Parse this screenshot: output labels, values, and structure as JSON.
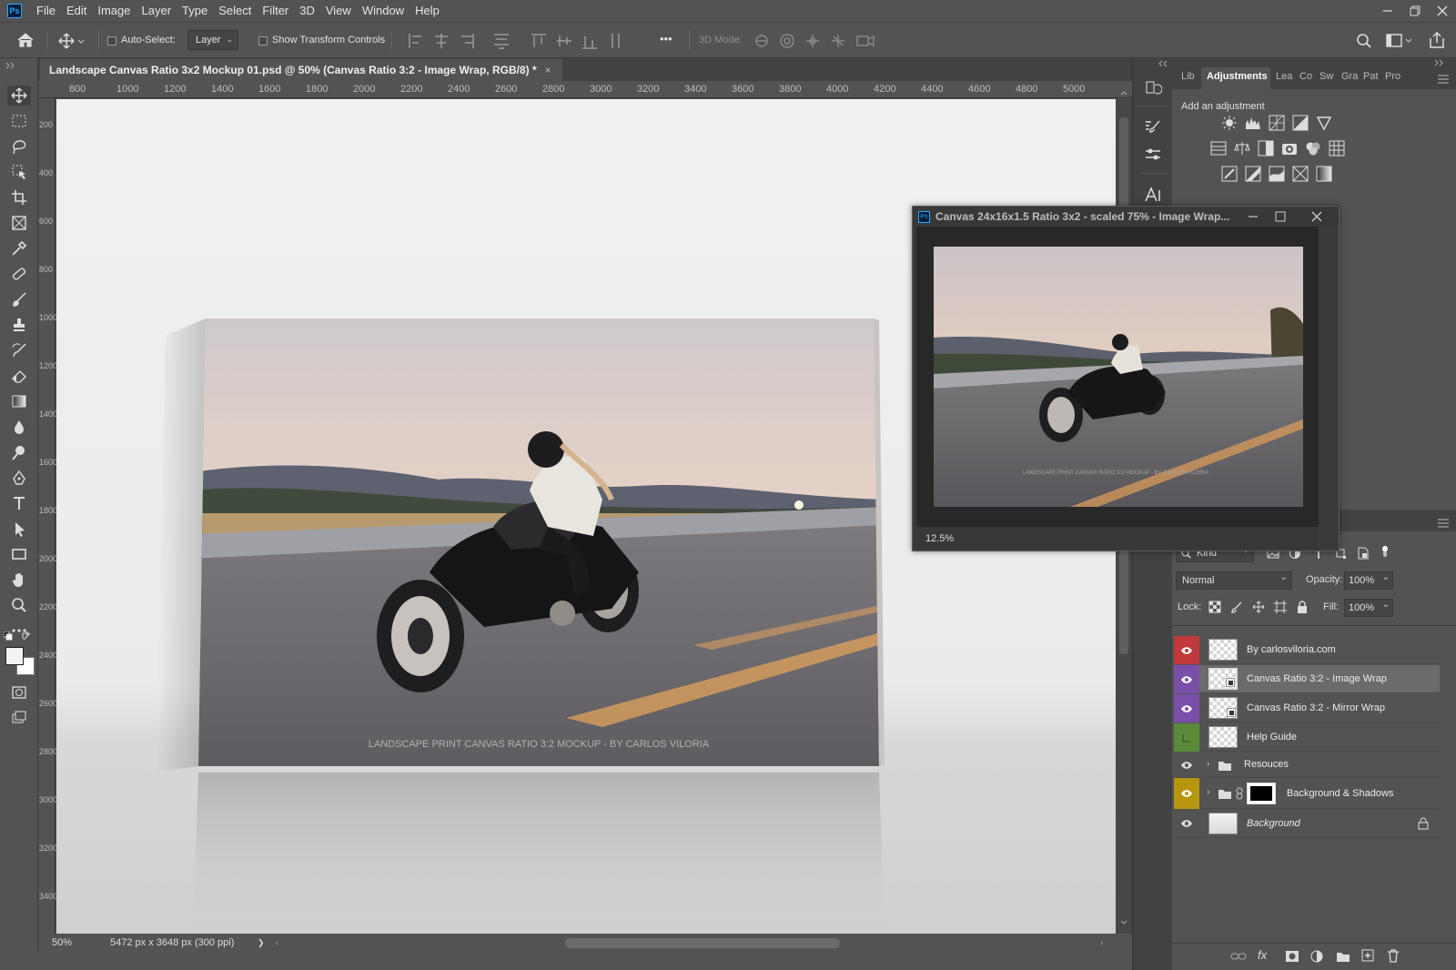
{
  "app": {
    "logo": "Ps"
  },
  "menu": [
    "File",
    "Edit",
    "Image",
    "Layer",
    "Type",
    "Select",
    "Filter",
    "3D",
    "View",
    "Window",
    "Help"
  ],
  "options_bar": {
    "auto_select_label": "Auto-Select:",
    "auto_select_target": "Layer",
    "show_transform_label": "Show Transform Controls",
    "more": "•••",
    "mode_3d_label": "3D Mode:"
  },
  "document": {
    "tab_title": "Landscape Canvas Ratio 3x2 Mockup 01.psd @ 50% (Canvas Ratio 3:2 - Image Wrap, RGB/8) *",
    "tab_close": "×",
    "ruler_h": [
      "800",
      "1000",
      "1200",
      "1400",
      "1600",
      "1800",
      "2000",
      "2200",
      "2400",
      "2600",
      "2800",
      "3000",
      "3200",
      "3400",
      "3600",
      "3800",
      "4000",
      "4200",
      "4400",
      "4600",
      "4800",
      "5000"
    ],
    "ruler_v": [
      "200",
      "400",
      "600",
      "800",
      "1000",
      "1200",
      "1400",
      "1600",
      "1800",
      "2000",
      "2200",
      "2400",
      "2600",
      "2800",
      "3000",
      "3200",
      "3400"
    ],
    "canvas_watermark": "LANDSCAPE PRINT CANVAS RATIO 3:2 MOCKUP - BY CARLOS VILORIA",
    "status_zoom": "50%",
    "status_info": "5472 px x 3648 px (300 ppi)",
    "status_arrow": "❯"
  },
  "floating_window": {
    "title": "Canvas 24x16x1.5 Ratio 3x2 - scaled 75% - Image Wrap...",
    "zoom": "12.5%",
    "watermark": "LANDSCAPE PRINT CANVAS RATIO 3:2 MOCKUP - BY CARLOS VILORIA"
  },
  "panel_tabs": [
    "Lib",
    "Adjustments",
    "Lea",
    "Co",
    "Sw",
    "Gra",
    "Pat",
    "Pro"
  ],
  "active_panel_tab": "Adjustments",
  "adjustments": {
    "heading": "Add an adjustment"
  },
  "layers": {
    "filter_kind": "Kind",
    "blend_mode": "Normal",
    "opacity_label": "Opacity:",
    "opacity_value": "100%",
    "lock_label": "Lock:",
    "fill_label": "Fill:",
    "fill_value": "100%",
    "items": [
      {
        "name": "By carlosviloria.com",
        "color": "#c0393b",
        "visible": true,
        "selected": false
      },
      {
        "name": "Canvas Ratio 3:2 - Image Wrap",
        "color": "#7a4fa8",
        "visible": true,
        "selected": true
      },
      {
        "name": "Canvas Ratio 3:2 - Mirror Wrap",
        "color": "#7a4fa8",
        "visible": true,
        "selected": false
      },
      {
        "name": "Help Guide",
        "color": "#5b8a3a",
        "visible": false,
        "selected": false
      },
      {
        "name": "Resouces",
        "color": "",
        "visible": true,
        "selected": false
      },
      {
        "name": "Background & Shadows",
        "color": "#b5960e",
        "visible": true,
        "selected": false
      },
      {
        "name": "Background",
        "color": "",
        "visible": true,
        "selected": false
      }
    ]
  },
  "colors": {
    "accent_blue": "#31a8ff",
    "panel_bg": "#535353",
    "dark_bg": "#424242"
  },
  "icons": [
    "home-icon",
    "move-icon",
    "align-icons",
    "3d-mode-icons",
    "search-icon",
    "workspace-icon",
    "share-icon",
    "eye-icon",
    "lock-icon",
    "folder-icon",
    "link-icon",
    "fx-icon",
    "mask-icon",
    "adjustment-layer-icon",
    "new-group-icon",
    "new-layer-icon",
    "trash-icon"
  ]
}
